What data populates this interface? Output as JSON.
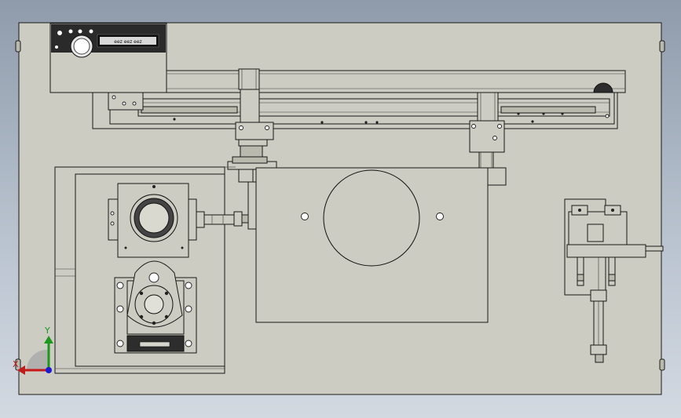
{
  "panel": {
    "display_text": "eez eez eez"
  },
  "triad": {
    "y_label": "Y",
    "x_label": "X"
  }
}
